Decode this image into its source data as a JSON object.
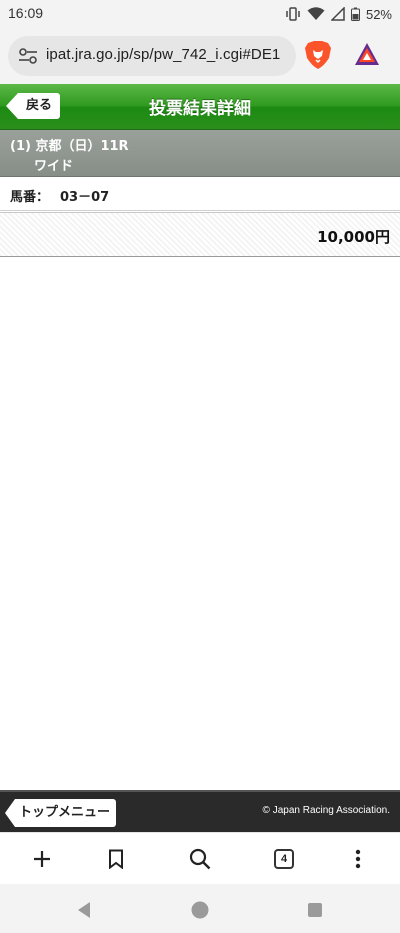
{
  "status_bar": {
    "time": "16:09",
    "battery": "52%",
    "icons": [
      "vibrate-icon",
      "wifi-icon",
      "signal-icon",
      "battery-icon"
    ]
  },
  "browser": {
    "url": "ipat.jra.go.jp/sp/pw_742_i.cgi#DE1",
    "icons": [
      "site-settings-icon",
      "brave-lion-icon",
      "brave-rewards-icon"
    ]
  },
  "header": {
    "back_label": "戻る",
    "title": "投票結果詳細",
    "accent_color": "#2f9a1f"
  },
  "race": {
    "line1": "(1) 京都（日）11R",
    "bet_type": "ワイド"
  },
  "horse": {
    "label": "馬番：",
    "value": "03－07"
  },
  "amount": {
    "value": "10,000円"
  },
  "footer": {
    "top_menu_label": "トップメニュー",
    "copyright": "© Japan Racing Association."
  },
  "toolbar": {
    "tab_count": "4",
    "icons": [
      "plus-icon",
      "bookmark-icon",
      "search-icon",
      "tabs-icon",
      "more-icon"
    ]
  },
  "nav": {
    "icons": [
      "back-triangle-icon",
      "home-circle-icon",
      "recents-square-icon"
    ]
  }
}
